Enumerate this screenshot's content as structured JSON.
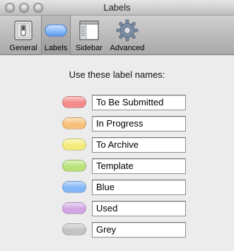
{
  "window": {
    "title": "Labels"
  },
  "toolbar": {
    "items": [
      {
        "label": "General",
        "icon": "switch-icon"
      },
      {
        "label": "Labels",
        "icon": "label-pill-icon"
      },
      {
        "label": "Sidebar",
        "icon": "sidebar-window-icon"
      },
      {
        "label": "Advanced",
        "icon": "gear-icon"
      }
    ],
    "selected": "Labels"
  },
  "main": {
    "heading": "Use these label names:",
    "labels": [
      {
        "name": "To Be Submitted",
        "color": "#f48a8a"
      },
      {
        "name": "In Progress",
        "color": "#f7c07a"
      },
      {
        "name": "To Archive",
        "color": "#f3ec7a"
      },
      {
        "name": "Template",
        "color": "#b9e27a"
      },
      {
        "name": "Blue",
        "color": "#84b7f6"
      },
      {
        "name": "Used",
        "color": "#d2a6e2"
      },
      {
        "name": "Grey",
        "color": "#c3c3c3"
      }
    ]
  }
}
